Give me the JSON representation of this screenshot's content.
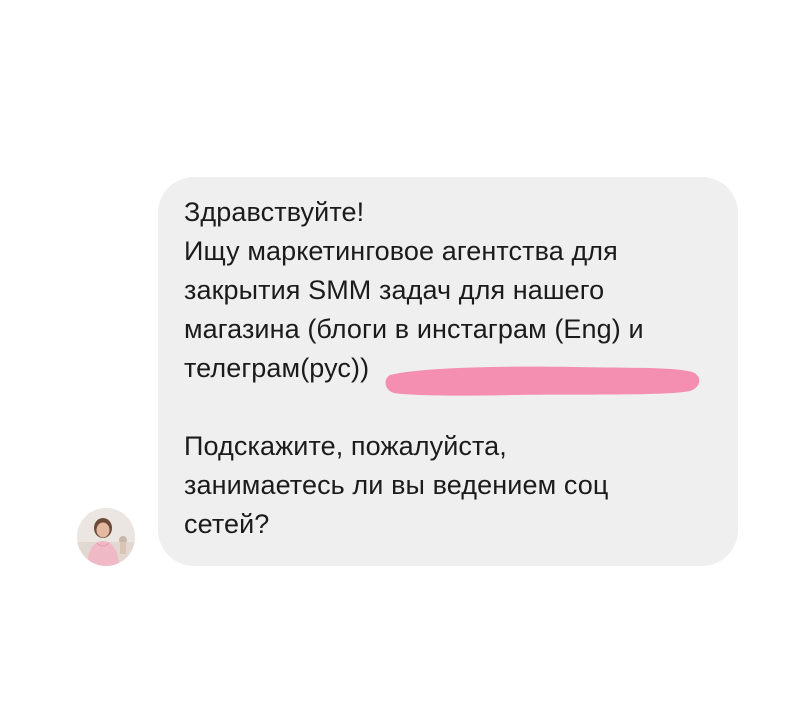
{
  "message": {
    "lines": [
      "Здравствуйте!",
      "Ищу маркетинговое агентства для",
      "закрытия SMM задач для нашего",
      "магазина (блоги в инстаграм (Eng) и",
      "телеграм(рус))"
    ],
    "lines2": [
      "Подскажите, пожалуйста,",
      "занимаетесь ли вы ведением соц",
      "сетей?"
    ]
  },
  "colors": {
    "bubble": "#efefef",
    "text": "#1b1b1b",
    "redaction": "#f48fb1"
  },
  "icons": {
    "avatar": "sender-avatar-photo"
  }
}
